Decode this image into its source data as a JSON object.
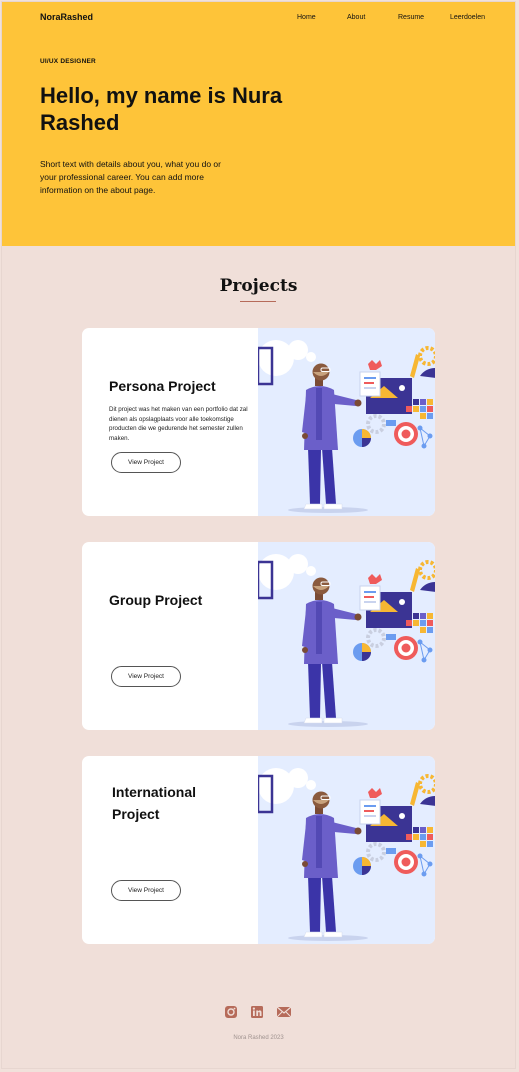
{
  "header": {
    "brand": "NoraRashed",
    "nav": [
      "Home",
      "About",
      "Resume",
      "Leerdoelen"
    ]
  },
  "hero": {
    "tag": "UI/UX DESIGNER",
    "headline": "Hello,  my name is Nura Rashed",
    "intro": "Short text with details about you, what you do or your professional career. You can add more information on the about page."
  },
  "projects": {
    "title": "Projects",
    "cards": [
      {
        "title": "Persona Project",
        "description": "Dit project was het  maken van een portfolio dat zal dienen als opslagplaats voor alle toekomstige producten die we gedurende het semester zullen maken.",
        "button": "View Project"
      },
      {
        "title": "Group Project",
        "description": "",
        "button": "View Project"
      },
      {
        "title": "International Project",
        "description": "",
        "button": "View Project"
      }
    ]
  },
  "footer": {
    "icons": [
      "instagram-icon",
      "linkedin-icon",
      "mail-icon"
    ],
    "copyright": "Nora Rashed 2023"
  },
  "colors": {
    "hero_bg": "#fec439",
    "page_bg": "#f0dfd9",
    "accent": "#b66b5a",
    "illustration_bg": "#e4edff"
  }
}
